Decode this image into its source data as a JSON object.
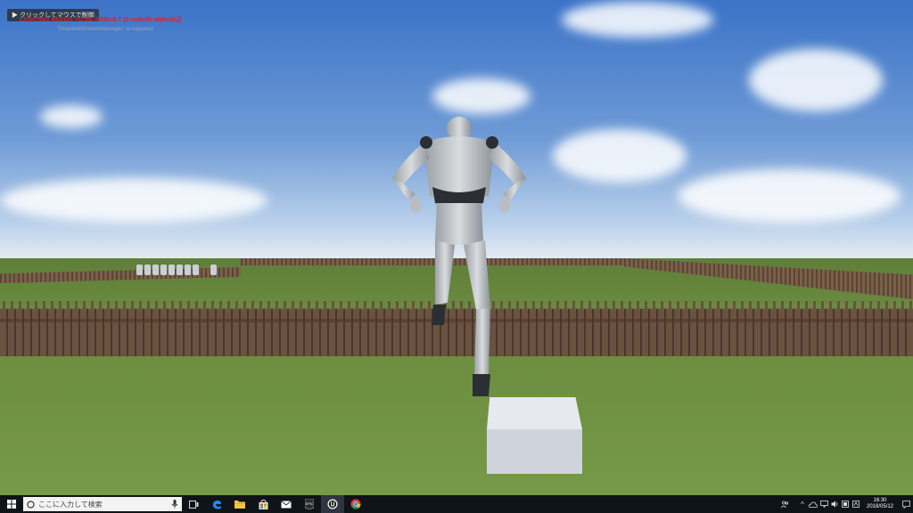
{
  "viewport": {
    "hint": "クリックしてマウスで制御",
    "warning": "LIGHTING NEEDS TO BE REBUILT (3 unbuilt object(s))",
    "sub": "'DisableAllScreenMessages' to suppress"
  },
  "taskbar": {
    "search_placeholder": "ここに入力して検索",
    "apps": [
      "task-view",
      "edge",
      "file-explorer",
      "store",
      "mail",
      "epic-games-launcher",
      "unreal-engine",
      "chrome"
    ],
    "active_app": "unreal-engine",
    "epic_label": "EPIC",
    "time": "16:30",
    "date": "2018/05/12"
  },
  "colors": {
    "warning": "#e81b1b",
    "taskbar_bg": "#0f1418",
    "windows_blue": "#0a84d8"
  }
}
